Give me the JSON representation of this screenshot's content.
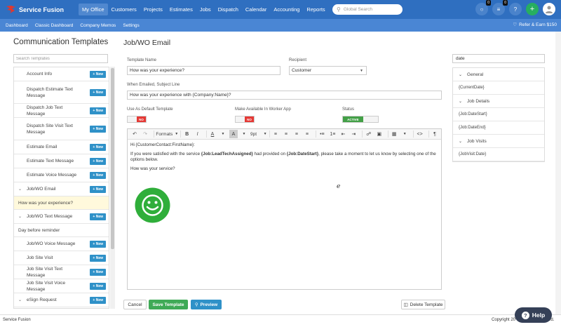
{
  "brand": {
    "name": "Service Fusion"
  },
  "nav": {
    "items": [
      "My Office",
      "Customers",
      "Projects",
      "Estimates",
      "Jobs",
      "Dispatch",
      "Calendar",
      "Accounting",
      "Reports"
    ],
    "active": "My Office"
  },
  "global_search": {
    "placeholder": "Global Search"
  },
  "nav_icons": {
    "chat_badge": "0",
    "list_badge": "0",
    "help_glyph": "?",
    "add_glyph": "+"
  },
  "subnav": {
    "items": [
      "Dashboard",
      "Classic Dashboard",
      "Company Memos",
      "Settings"
    ],
    "refer": "Refer & Earn $150"
  },
  "left": {
    "title": "Communication Templates",
    "search_placeholder": "Search Templates",
    "new_label": "+ New",
    "templates": [
      {
        "label": "Account Info",
        "type": "row"
      },
      {
        "label": "Dispatch Estimate Text Message",
        "type": "row"
      },
      {
        "label": "Dispatch Job Text Message",
        "type": "row"
      },
      {
        "label": "Dispatch Site Visit Text Message",
        "type": "row"
      },
      {
        "label": "Estimate Email",
        "type": "row"
      },
      {
        "label": "Estimate Text Message",
        "type": "row"
      },
      {
        "label": "Estimate Voice Message",
        "type": "row"
      },
      {
        "label": "Job/WO Email",
        "type": "expanded"
      },
      {
        "label": "How was your experience?",
        "type": "sub",
        "highlight": true
      },
      {
        "label": "Job/WO Text Message",
        "type": "expanded"
      },
      {
        "label": "Day before reminder",
        "type": "sub",
        "highlight": false
      },
      {
        "label": "Job/WO Voice Message",
        "type": "row"
      },
      {
        "label": "Job Site Visit",
        "type": "row"
      },
      {
        "label": "Job Site Visit Text Message",
        "type": "row"
      },
      {
        "label": "Job Site Visit Voice Message",
        "type": "row"
      },
      {
        "label": "eSign Request",
        "type": "expanded"
      }
    ]
  },
  "form": {
    "title": "Job/WO Email",
    "template_name_label": "Template Name",
    "template_name_value": "How was your experience?",
    "recipient_label": "Recipient",
    "recipient_value": "Customer",
    "subject_label": "When Emailed, Subject Line",
    "subject_value": "How was your experience with {Company:Name}?",
    "default_label": "Use As Default Template",
    "default_value": "NO",
    "worker_label": "Make Available In Worker App",
    "worker_value": "NO",
    "status_label": "Status",
    "status_value": "ACTIVE"
  },
  "editor": {
    "toolbar": {
      "formats": "Formats",
      "font_size": "9pt"
    },
    "greeting": "Hi {CustomerContact:FirstName}:",
    "body_1": "If you were satisfied with the service ",
    "body_var_1": "{Job:LeadTechAssigned}",
    "body_2": " had provided on ",
    "body_var_2": "{Job:DateStart}",
    "body_3": ", please take a moment to let us know by selecting one of the options below.",
    "question": "How was your service?",
    "colors": {
      "smiley": "#2fae3a"
    }
  },
  "buttons": {
    "cancel": "Cancel",
    "save": "Save Template",
    "preview": "Preview",
    "delete": "Delete Template"
  },
  "right": {
    "search_value": "date",
    "groups": [
      {
        "label": "General",
        "vars": [
          "{CurrentDate}"
        ]
      },
      {
        "label": "Job Details",
        "vars": [
          "{Job:DateStart}",
          "{Job:DateEnd}"
        ]
      },
      {
        "label": "Job Visits",
        "vars": [
          "{JobVisit:Date}"
        ]
      }
    ]
  },
  "footer": {
    "left": "Service Fusion",
    "right": "Copyright 20",
    "right_tail": "ved."
  },
  "help": {
    "label": "Help",
    "glyph": "?"
  }
}
